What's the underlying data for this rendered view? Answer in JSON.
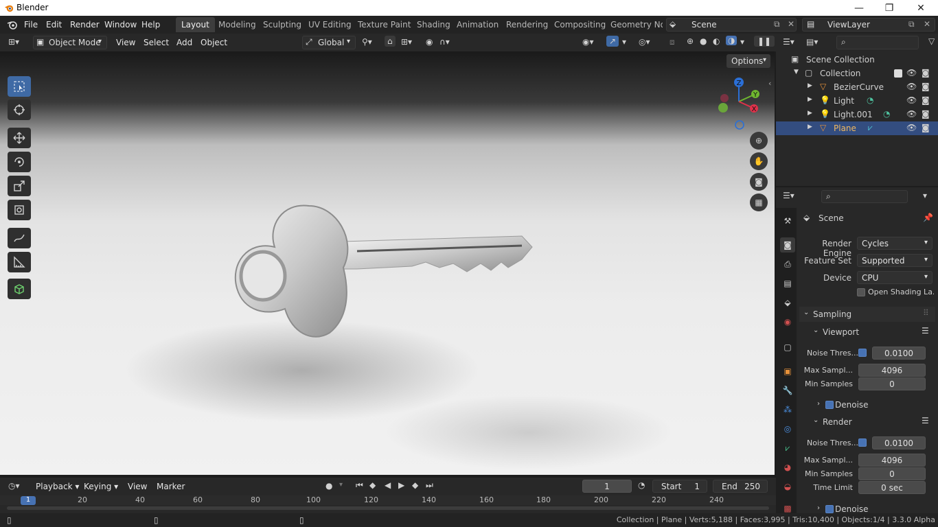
{
  "window": {
    "title": "Blender",
    "minimize": "—",
    "maximize": "❐",
    "close": "✕"
  },
  "menu": [
    "File",
    "Edit",
    "Render",
    "Window",
    "Help"
  ],
  "workspaces": [
    "Layout",
    "Modeling",
    "Sculpting",
    "UV Editing",
    "Texture Paint",
    "Shading",
    "Animation",
    "Rendering",
    "Compositing",
    "Geometry Noc"
  ],
  "active_workspace": "Layout",
  "scene": {
    "name": "Scene"
  },
  "view_layer": {
    "name": "ViewLayer"
  },
  "viewport_header": {
    "mode": "Object Mode",
    "menus": [
      "View",
      "Select",
      "Add",
      "Object"
    ],
    "orientation": "Global",
    "options": "Options"
  },
  "gizmo": {
    "z": "Z",
    "y": "Y",
    "x": "X"
  },
  "outliner": {
    "scene_collection": "Scene Collection",
    "collection": "Collection",
    "items": [
      {
        "name": "BezierCurve",
        "selected": false
      },
      {
        "name": "Light",
        "selected": false
      },
      {
        "name": "Light.001",
        "selected": false
      },
      {
        "name": "Plane",
        "selected": true
      }
    ]
  },
  "properties": {
    "context": "Scene",
    "render_engine_label": "Render Engine",
    "render_engine": "Cycles",
    "feature_set_label": "Feature Set",
    "feature_set": "Supported",
    "device_label": "Device",
    "device": "CPU",
    "osl_label": "Open Shading La...",
    "sampling": "Sampling",
    "viewport": {
      "title": "Viewport",
      "noise_label": "Noise Thres...",
      "noise": "0.0100",
      "max_label": "Max Sampl...",
      "max": "4096",
      "min_label": "Min Samples",
      "min": "0",
      "denoise": "Denoise"
    },
    "render": {
      "title": "Render",
      "noise_label": "Noise Thres...",
      "noise": "0.0100",
      "max_label": "Max Sampl...",
      "max": "4096",
      "min_label": "Min Samples",
      "min": "0",
      "time_label": "Time Limit",
      "time": "0 sec",
      "denoise": "Denoise"
    }
  },
  "timeline": {
    "menus": [
      "Playback",
      "Keying",
      "View",
      "Marker"
    ],
    "current_frame": "1",
    "start_label": "Start",
    "start": "1",
    "end_label": "End",
    "end": "250",
    "ruler": [
      "20",
      "40",
      "60",
      "80",
      "100",
      "120",
      "140",
      "160",
      "180",
      "200",
      "220",
      "240"
    ],
    "ruler_current": "1"
  },
  "status": "Collection | Plane | Verts:5,188 | Faces:3,995 | Tris:10,400 | Objects:1/4 | 3.3.0 Alpha",
  "colors": {
    "accent": "#4772b3",
    "selection": "#334d80",
    "object_orange": "#e8923a"
  }
}
